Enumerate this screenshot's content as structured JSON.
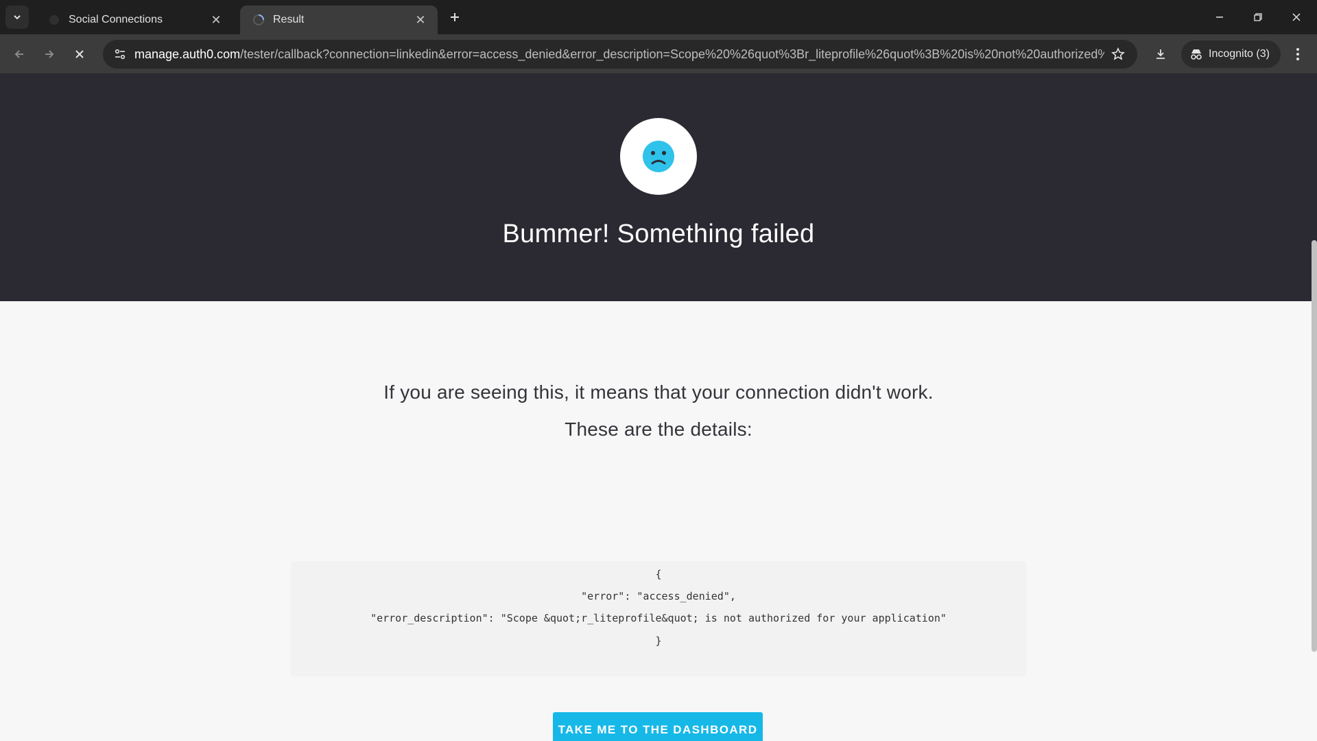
{
  "browser": {
    "tabs": [
      {
        "title": "Social Connections",
        "active": false
      },
      {
        "title": "Result",
        "active": true
      }
    ],
    "url_host": "manage.auth0.com",
    "url_rest": "/tester/callback?connection=linkedin&error=access_denied&error_description=Scope%20%26quot%3Br_liteprofile%26quot%3B%20is%20not%20authorized%20f...",
    "incognito_label": "Incognito (3)"
  },
  "page": {
    "title": "Bummer! Something failed",
    "message_line1": "If you are seeing this, it means that your connection didn't work.",
    "message_line2": "These are the details:",
    "details": {
      "open": "{",
      "error_line": "\"error\": \"access_denied\",",
      "description_line": "\"error_description\": \"Scope &quot;r_liteprofile&quot; is not authorized for your application\"",
      "close": "}"
    },
    "cta_label": "TAKE ME TO THE DASHBOARD"
  },
  "colors": {
    "hero_bg": "#2b2a33",
    "accent": "#16b8e8",
    "page_bg": "#f7f7f8"
  }
}
